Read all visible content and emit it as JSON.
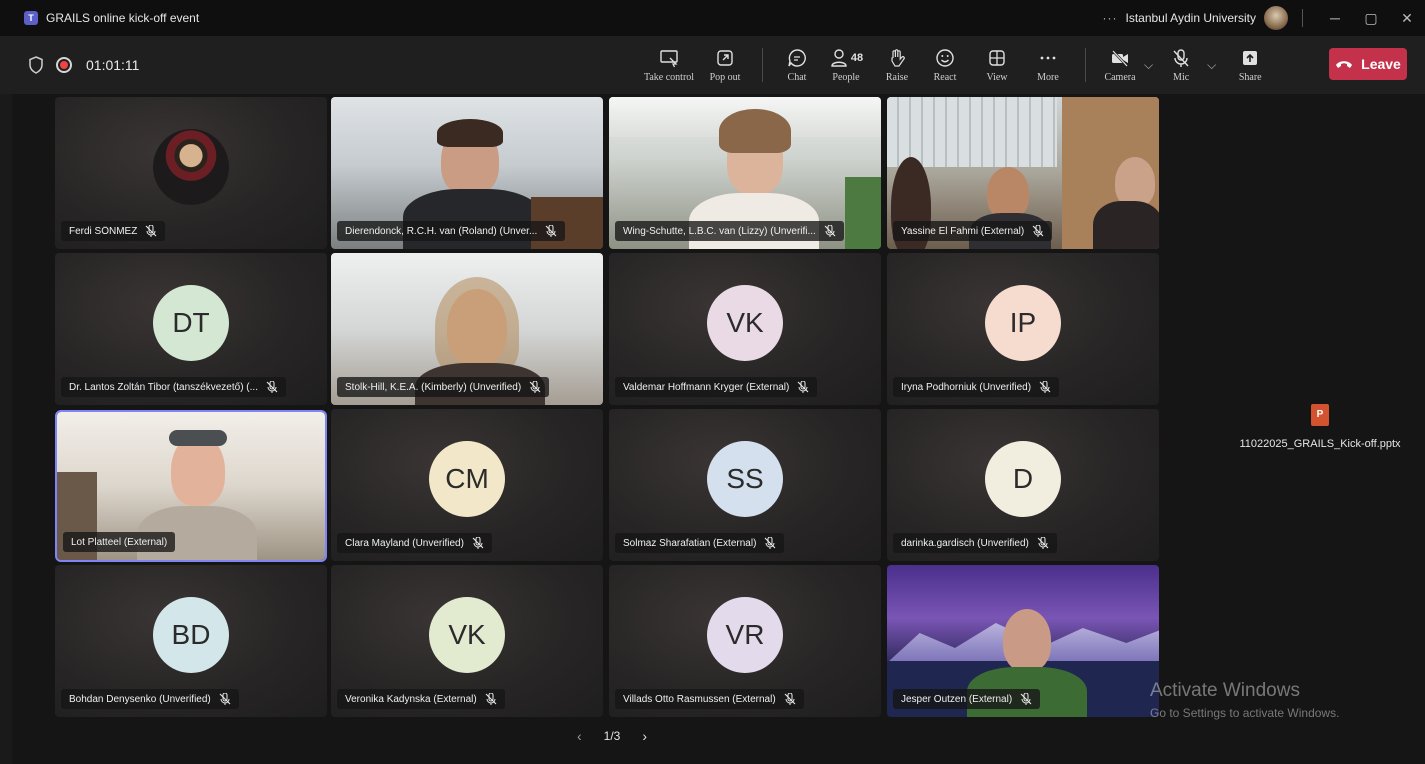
{
  "window": {
    "title": "GRAILS online kick-off event",
    "more_dots": "···",
    "org": "Istanbul Aydin University",
    "minimize": "─",
    "maximize": "▢",
    "close": "✕"
  },
  "toolbar": {
    "timer": "01:01:11",
    "take_control": "Take control",
    "pop_out": "Pop out",
    "chat": "Chat",
    "people": "People",
    "people_count": "48",
    "raise": "Raise",
    "react": "React",
    "view": "View",
    "more": "More",
    "camera": "Camera",
    "mic": "Mic",
    "share": "Share",
    "leave": "Leave",
    "chevron": "⌵"
  },
  "participants": [
    {
      "name": "Ferdi SÖNMEZ",
      "kind": "photo"
    },
    {
      "name": "Dierendonck, R.C.H. van (Roland) (Unver...",
      "kind": "video"
    },
    {
      "name": "Wing-Schutte, L.B.C. van (Lizzy) (Unverifi...",
      "kind": "video"
    },
    {
      "name": "Yassine El Fahmi (External)",
      "kind": "video"
    },
    {
      "name": "Dr. Lantos Zoltán Tibor (tanszékvezető) (...",
      "initials": "DT",
      "color": "#d4e7d3"
    },
    {
      "name": "Stolk-Hill, K.E.A. (Kimberly) (Unverified)",
      "kind": "video"
    },
    {
      "name": "Valdemar Hoffmann Kryger (External)",
      "initials": "VK",
      "color": "#eadae6"
    },
    {
      "name": "Iryna Podhorniuk (Unverified)",
      "initials": "IP",
      "color": "#f5dccf"
    },
    {
      "name": "Lot Platteel (External)",
      "kind": "video"
    },
    {
      "name": "Clara Mayland (Unverified)",
      "initials": "CM",
      "color": "#f2e8c9"
    },
    {
      "name": "Solmaz Sharafatian (External)",
      "initials": "SS",
      "color": "#d5e0ee"
    },
    {
      "name": "darinka.gardisch (Unverified)",
      "initials": "D",
      "color": "#f1eddf"
    },
    {
      "name": "Bohdan Denysenko (Unverified)",
      "initials": "BD",
      "color": "#d3e6ea"
    },
    {
      "name": "Veronika Kadynska (External)",
      "initials": "VK",
      "color": "#e2ead0"
    },
    {
      "name": "Villads Otto Rasmussen (External)",
      "initials": "VR",
      "color": "#e3dbec"
    },
    {
      "name": "Jesper Outzen (External)",
      "kind": "video"
    }
  ],
  "shared_file": {
    "icon": "ppt-icon",
    "name": "11022025_GRAILS_Kick-off.pptx",
    "badge": "P"
  },
  "pager": {
    "prev": "‹",
    "label": "1/3",
    "next": "›"
  },
  "watermark": {
    "title": "Activate Windows",
    "subtitle": "Go to Settings to activate Windows."
  },
  "app_logo": "T"
}
